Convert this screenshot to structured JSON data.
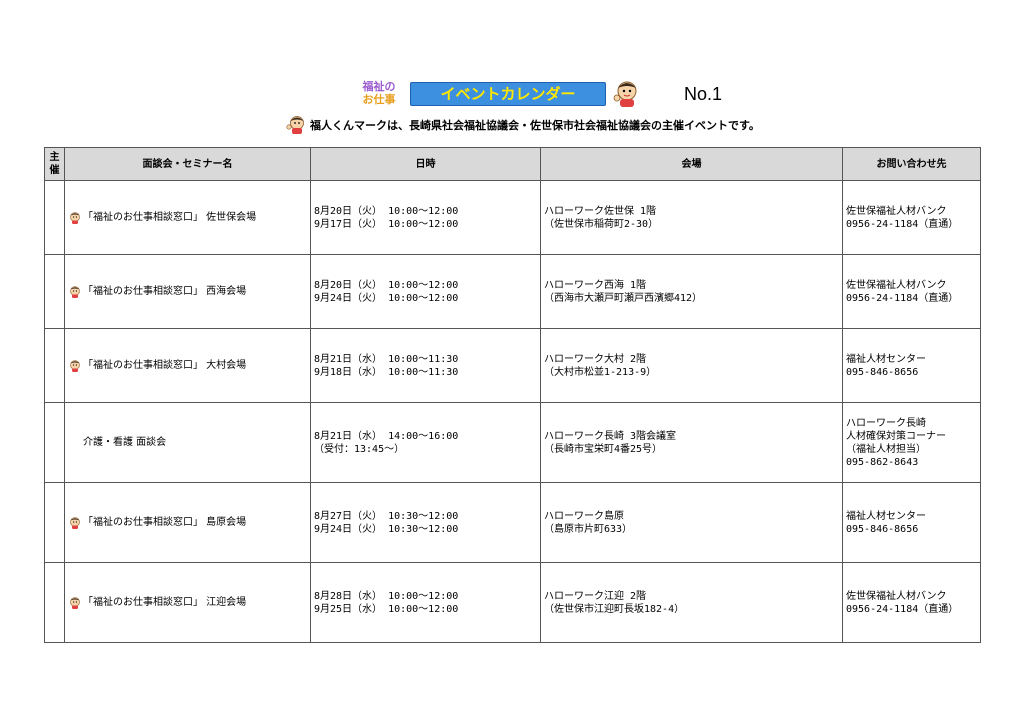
{
  "header": {
    "logo_line1": "福祉の",
    "logo_line2": "お仕事",
    "banner": "イベントカレンダー",
    "doc_no": "No.1",
    "subtitle": "福人くんマークは、長崎県社会福祉協議会・佐世保市社会福祉協議会の主催イベントです。"
  },
  "table": {
    "headers": {
      "organizer": "主催",
      "name": "面談会・セミナー名",
      "datetime": "日時",
      "venue": "会場",
      "contact": "お問い合わせ先"
    },
    "rows": [
      {
        "organizer_icon": "fukujin-mascot-icon",
        "name": "「福祉のお仕事相談窓口」 佐世保会場",
        "datetime": [
          "8月20日（火） 10:00～12:00",
          "9月17日（火） 10:00～12:00"
        ],
        "venue": [
          "ハローワーク佐世保 1階",
          "（佐世保市稲荷町2-30）"
        ],
        "contact": [
          "佐世保福祉人材バンク",
          "0956-24-1184（直通）"
        ]
      },
      {
        "organizer_icon": "fukujin-mascot-icon",
        "name": "「福祉のお仕事相談窓口」 西海会場",
        "datetime": [
          "8月20日（火） 10:00～12:00",
          "9月24日（火） 10:00～12:00"
        ],
        "venue": [
          "ハローワーク西海 1階",
          "（西海市大瀬戸町瀬戸西濱郷412）"
        ],
        "contact": [
          "佐世保福祉人材バンク",
          "0956-24-1184（直通）"
        ]
      },
      {
        "organizer_icon": "fukujin-mascot-icon",
        "name": "「福祉のお仕事相談窓口」 大村会場",
        "datetime": [
          "8月21日（水） 10:00～11:30",
          "9月18日（水） 10:00～11:30"
        ],
        "venue": [
          "ハローワーク大村 2階",
          "（大村市松並1-213-9）"
        ],
        "contact": [
          "福祉人材センター",
          "095-846-8656"
        ]
      },
      {
        "organizer_icon": "",
        "name": "介護・看護 面談会",
        "datetime": [
          "8月21日（水） 14:00～16:00",
          "（受付：13:45～）"
        ],
        "venue": [
          "ハローワーク長崎 3階会議室",
          "（長崎市宝栄町4番25号）"
        ],
        "contact": [
          "ハローワーク長崎",
          "人材確保対策コーナー",
          "（福祉人材担当）",
          "095-862-8643"
        ]
      },
      {
        "organizer_icon": "fukujin-mascot-icon",
        "name": "「福祉のお仕事相談窓口」 島原会場",
        "datetime": [
          "8月27日（火） 10:30～12:00",
          "9月24日（火） 10:30～12:00"
        ],
        "venue": [
          "ハローワーク島原",
          "（島原市片町633）"
        ],
        "contact": [
          "福祉人材センター",
          "095-846-8656"
        ]
      },
      {
        "organizer_icon": "fukujin-mascot-icon",
        "name": "「福祉のお仕事相談窓口」 江迎会場",
        "datetime": [
          "8月28日（水） 10:00～12:00",
          "9月25日（水） 10:00～12:00"
        ],
        "venue": [
          "ハローワーク江迎 2階",
          "（佐世保市江迎町長坂182-4）"
        ],
        "contact": [
          "佐世保福祉人材バンク",
          "0956-24-1184（直通）"
        ]
      }
    ]
  },
  "colors": {
    "banner_bg": "#3d8fe0",
    "banner_text": "#ffe800",
    "header_bg": "#d9d9d9"
  }
}
